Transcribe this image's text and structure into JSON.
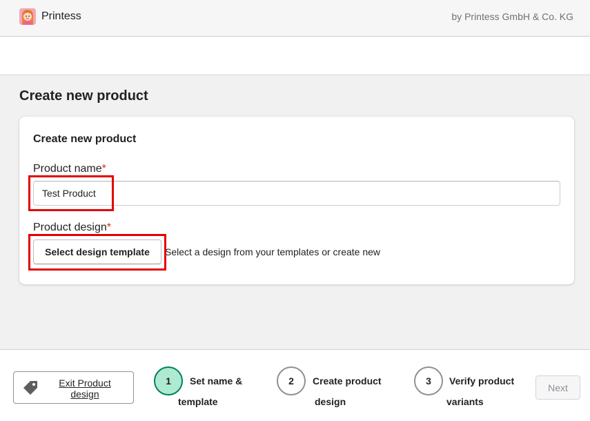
{
  "header": {
    "app_name": "Printess",
    "by_text": "by Printess GmbH & Co. KG"
  },
  "page": {
    "title": "Create new product"
  },
  "card": {
    "title": "Create new product",
    "product_name_label": "Product name",
    "product_name_value": "Test Product",
    "product_design_label": "Product design",
    "required_marker": "*",
    "select_template_label": "Select design template",
    "select_template_hint": "Select a design from your templates or create new"
  },
  "footer": {
    "exit_label": "Exit Product design",
    "steps": [
      {
        "number": "1",
        "label": "Set name & template",
        "active": true
      },
      {
        "number": "2",
        "label": "Create product design",
        "active": false
      },
      {
        "number": "3",
        "label": "Verify product variants",
        "active": false
      }
    ],
    "next_label": "Next"
  },
  "colors": {
    "highlight": "#e30000",
    "active_step_fill": "#aee9d1",
    "active_step_border": "#008060",
    "required": "#d72c0d"
  },
  "icons": {
    "logo": "printess-logo-icon",
    "exit": "tag-icon"
  }
}
